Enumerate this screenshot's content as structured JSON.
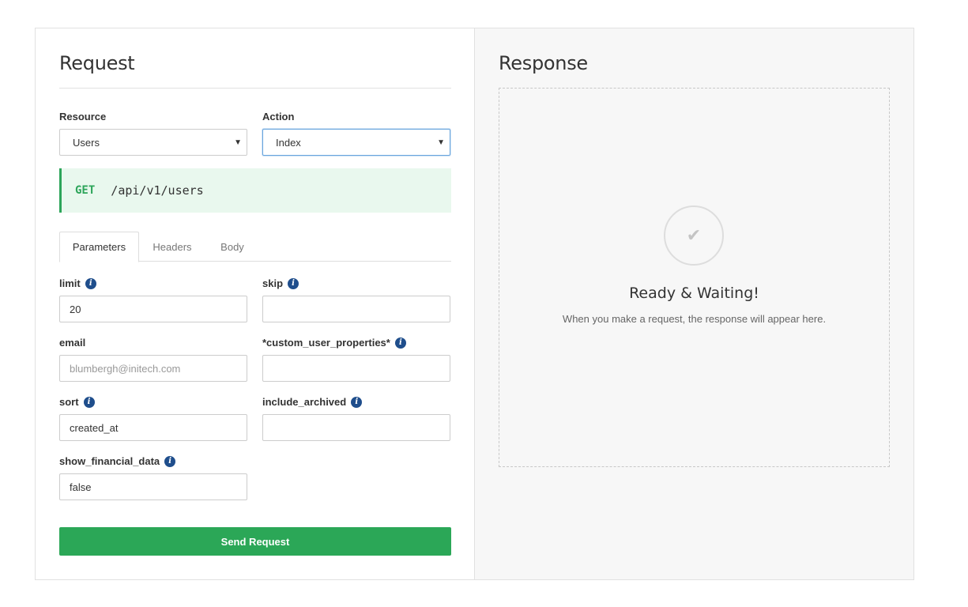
{
  "request": {
    "title": "Request",
    "resource": {
      "label": "Resource",
      "value": "Users"
    },
    "action": {
      "label": "Action",
      "value": "Index"
    },
    "endpoint": {
      "method": "GET",
      "path": "/api/v1/users"
    },
    "tabs": [
      {
        "label": "Parameters",
        "active": true
      },
      {
        "label": "Headers",
        "active": false
      },
      {
        "label": "Body",
        "active": false
      }
    ],
    "fields": {
      "limit": {
        "label": "limit",
        "value": "20",
        "placeholder": ""
      },
      "skip": {
        "label": "skip",
        "value": "",
        "placeholder": ""
      },
      "email": {
        "label": "email",
        "value": "",
        "placeholder": "blumbergh@initech.com"
      },
      "custom_user_properties": {
        "label": "*custom_user_properties*",
        "value": "",
        "placeholder": ""
      },
      "sort": {
        "label": "sort",
        "value": "created_at",
        "placeholder": ""
      },
      "include_archived": {
        "label": "include_archived",
        "value": "",
        "placeholder": ""
      },
      "show_financial_data": {
        "label": "show_financial_data",
        "value": "false",
        "placeholder": ""
      }
    },
    "send_label": "Send Request"
  },
  "response": {
    "title": "Response",
    "status_icon": "checkmark-icon",
    "waiting_title": "Ready & Waiting!",
    "waiting_subtitle": "When you make a request, the response will appear here."
  },
  "icons": {
    "info": "i",
    "check": "✔",
    "caret": "▼"
  },
  "colors": {
    "method_get": "#2da55a",
    "send_button": "#2ba757",
    "info_icon": "#1f4e8c",
    "endpoint_bg": "#e9f8ee"
  }
}
